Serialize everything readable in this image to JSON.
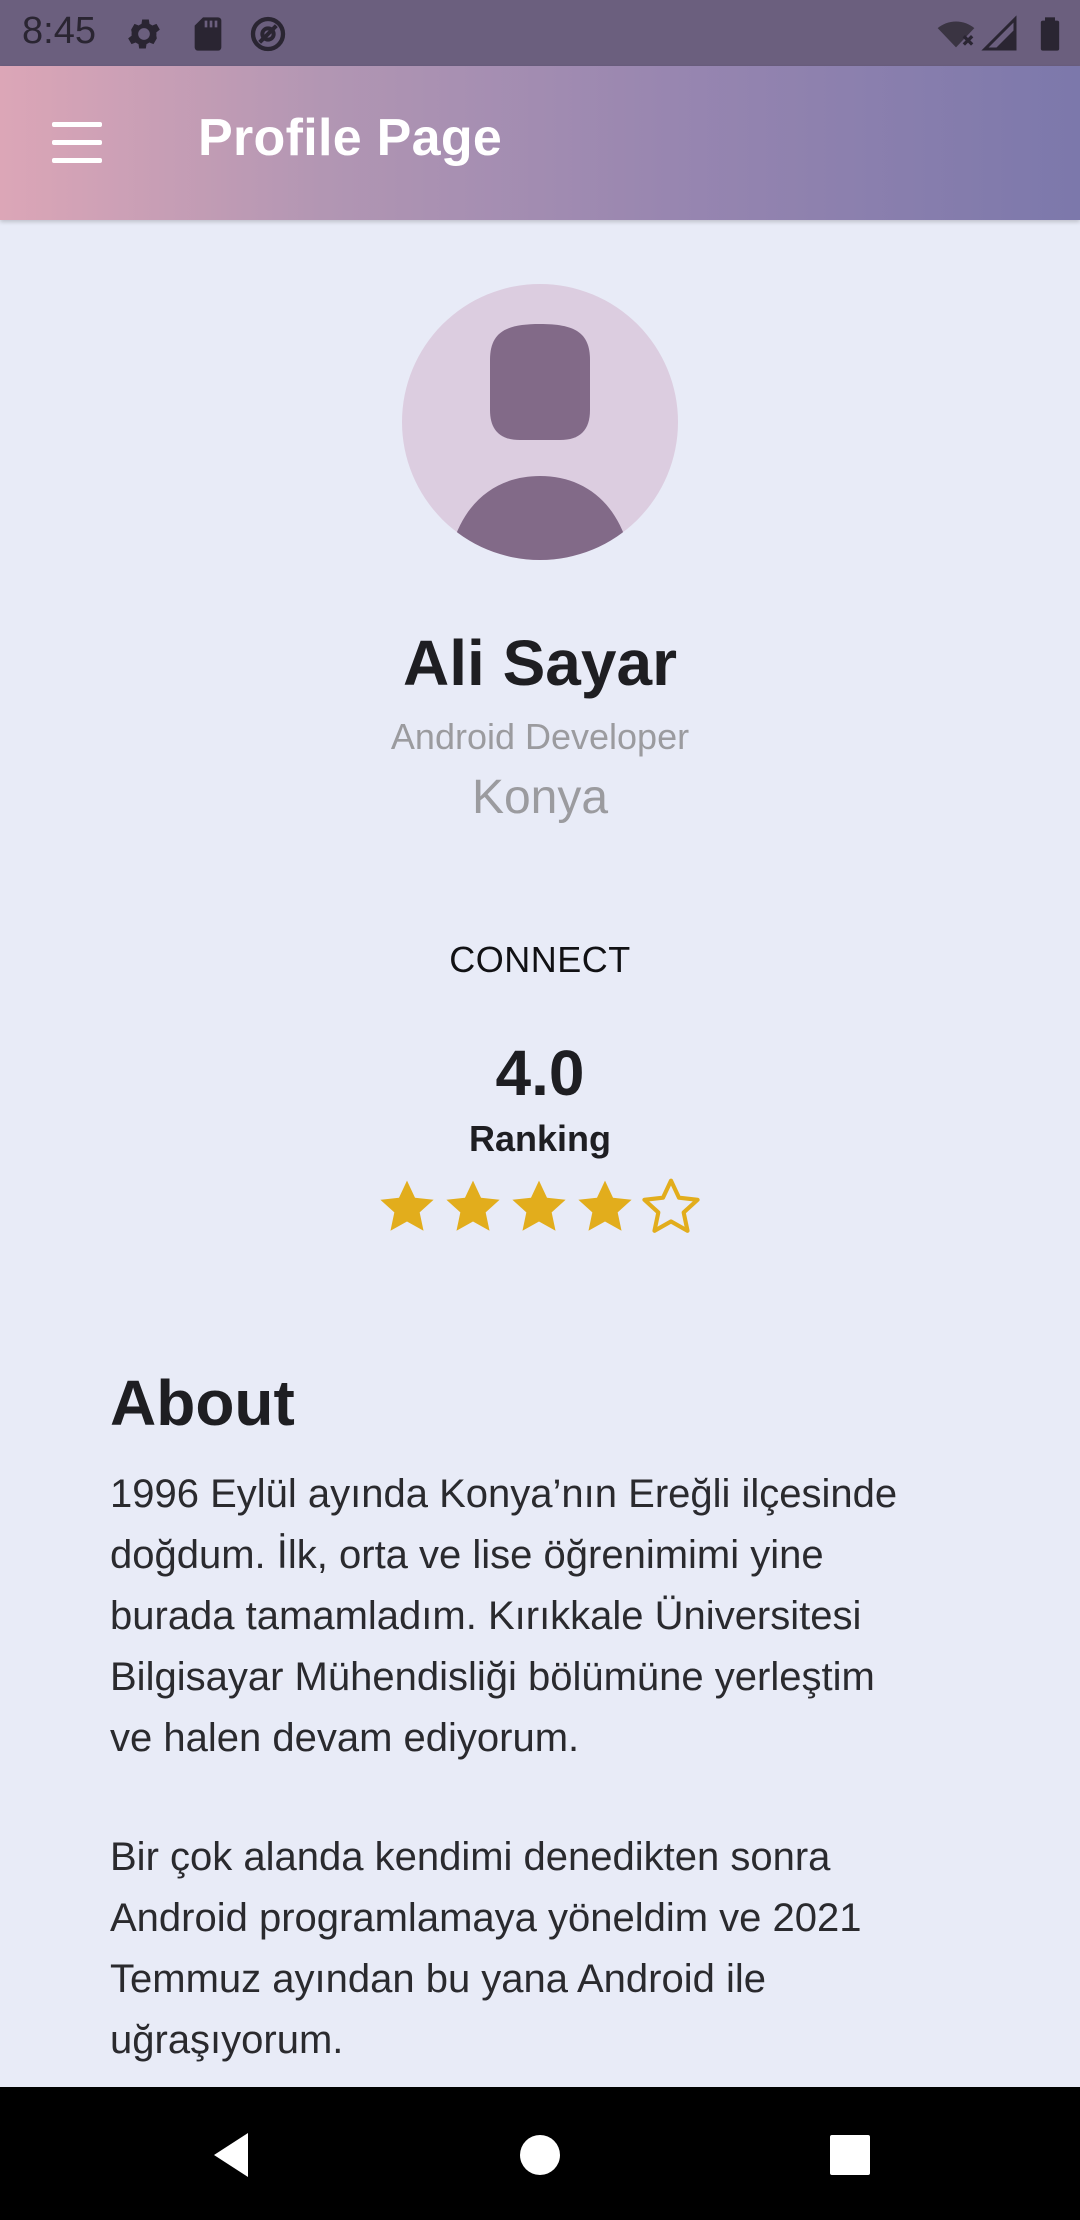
{
  "status_bar": {
    "time": "8:45",
    "icons_left": [
      "gear-icon",
      "sd-card-icon",
      "at-sign-icon"
    ],
    "icons_right": [
      "wifi-off-icon",
      "signal-icon",
      "battery-icon"
    ]
  },
  "app_bar": {
    "title": "Profile Page",
    "menu_icon": "hamburger-menu-icon"
  },
  "profile": {
    "name": "Ali Sayar",
    "role": "Android Developer",
    "city": "Konya",
    "connect_label": "CONNECT",
    "rating_value": "4.0",
    "rating_label": "Ranking",
    "stars": {
      "filled": 4,
      "total": 5,
      "color": "#e2ad1c"
    }
  },
  "about": {
    "heading": "About",
    "paragraph_1": "1996 Eylül ayında Konya’nın Ereğli ilçesinde\ndoğdum. İlk, orta ve lise öğrenimimi yine\nburada tamamladım. Kırıkkale Üniversitesi\nBilgisayar Mühendisliği bölümüne yerleştim\nve halen devam ediyorum.",
    "paragraph_2": "Bir çok alanda kendimi denedikten sonra\nAndroid programlamaya yöneldim ve 2021\nTemmuz ayından bu yana Android ile\nuğraşıyorum."
  },
  "nav_bar": {
    "buttons": [
      "back-triangle-icon",
      "home-circle-icon",
      "recents-square-icon"
    ]
  },
  "colors": {
    "background": "#e8ebf7",
    "app_bar_gradient_start": "#dca6b7",
    "app_bar_gradient_end": "#7c78ab",
    "avatar_bg": "#dccde0",
    "avatar_figure": "#826a88",
    "star": "#e2ad1c"
  }
}
